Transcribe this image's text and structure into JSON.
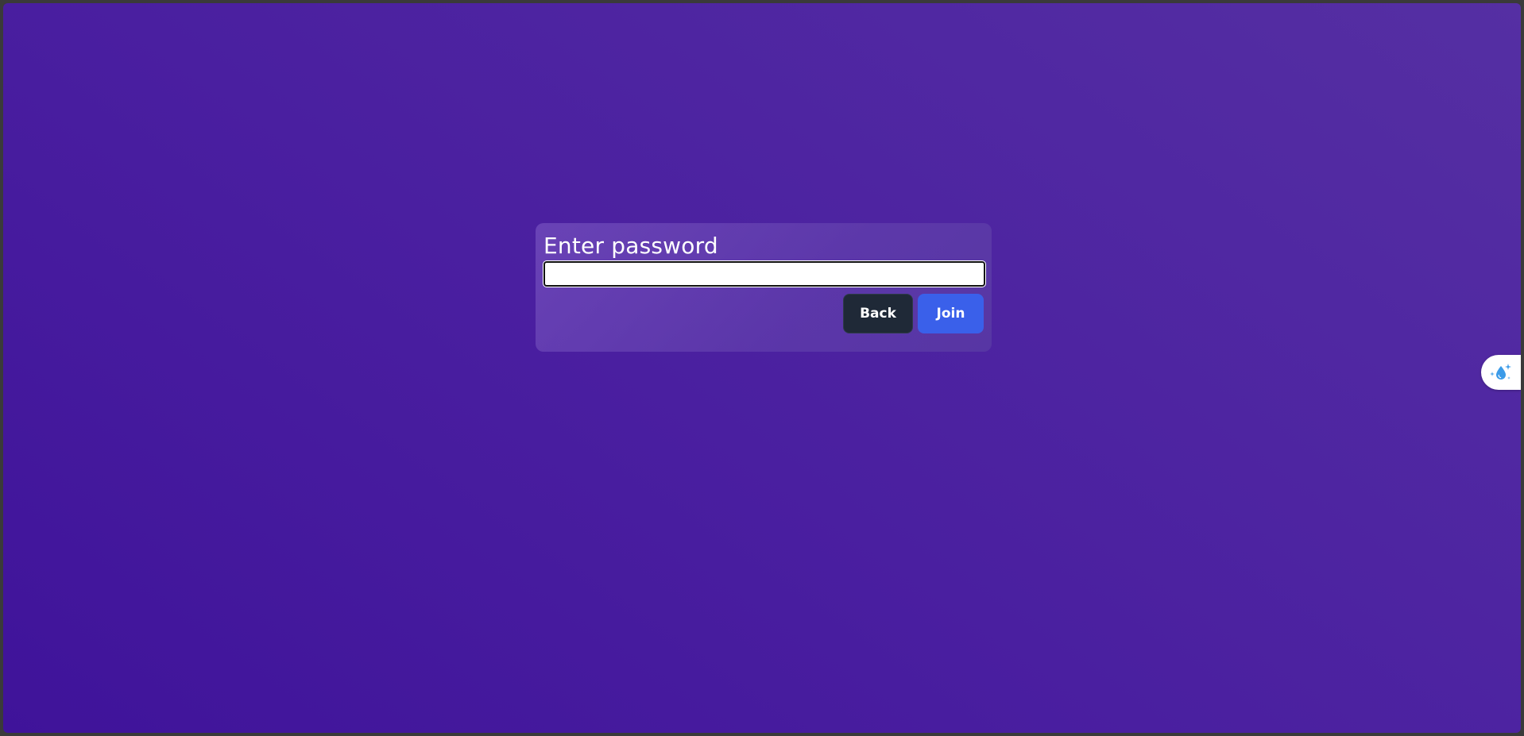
{
  "dialog": {
    "title": "Enter password",
    "password_value": "",
    "password_placeholder": "",
    "back_label": "Back",
    "join_label": "Join"
  },
  "side_widget": {
    "icon": "water-drop-sparkle-icon"
  },
  "colors": {
    "background_start": "#3f139a",
    "background_end": "#552fa3",
    "back_button": "#1f2937",
    "join_button": "#3a60ea",
    "icon_accent": "#3b9be8"
  }
}
